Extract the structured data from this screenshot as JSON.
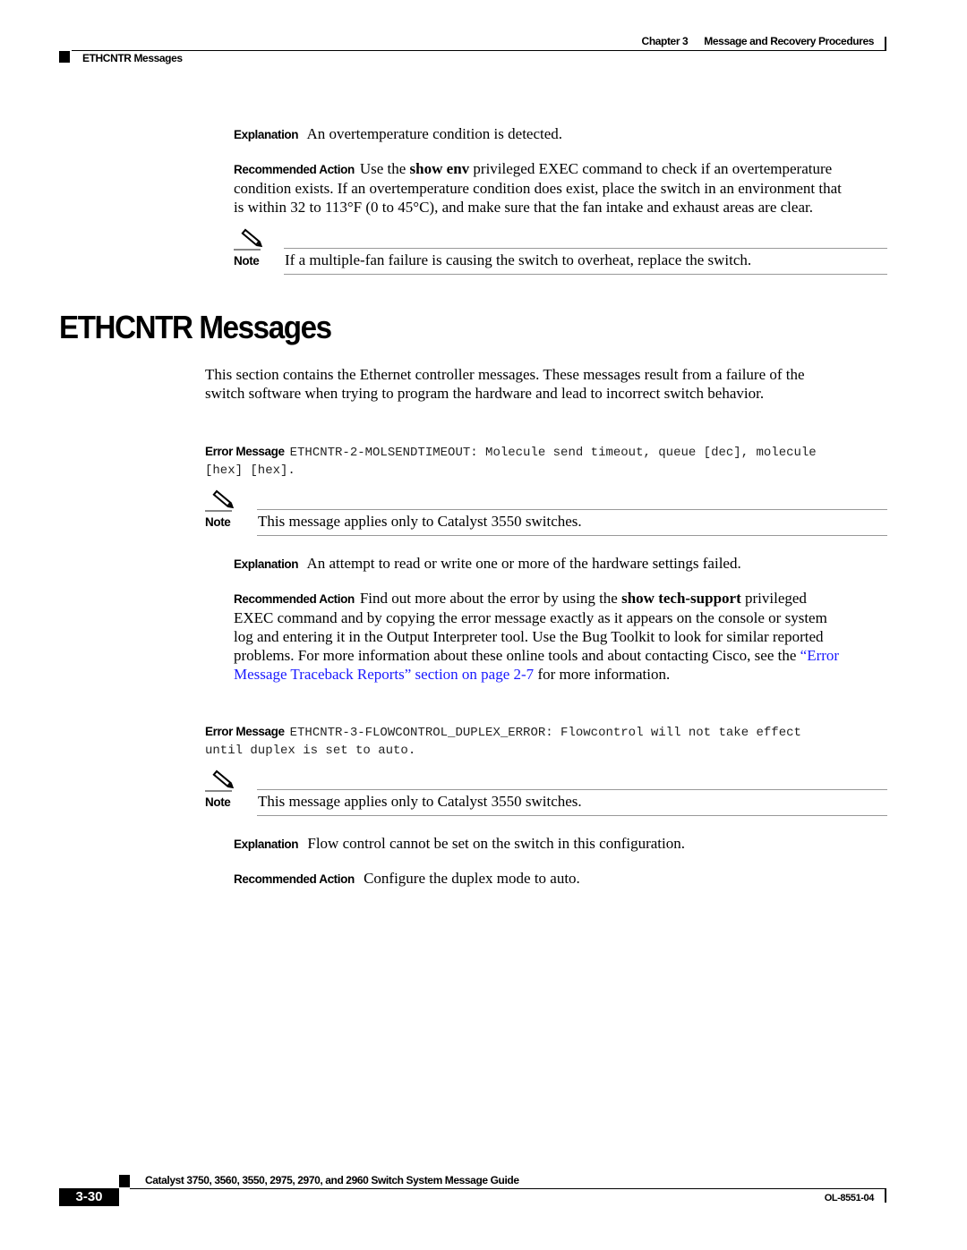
{
  "header": {
    "chapter": "Chapter 3",
    "chapter_title": "Message and Recovery Procedures",
    "section": "ETHCNTR Messages"
  },
  "top_block": {
    "explanation_label": "Explanation",
    "explanation_text": "An overtemperature condition is detected.",
    "action_label": "Recommended Action",
    "action_pre": "Use the ",
    "action_cmd": "show env",
    "action_line1_post": " privileged EXEC command to check if an overtemperature",
    "action_line2": "condition exists. If an overtemperature condition does exist, place the switch in an environment that",
    "action_line3": "is within 32 to 113°F (0 to 45°C), and make sure that the fan intake and exhaust areas are clear.",
    "note_label": "Note",
    "note_text": "If a multiple-fan failure is causing the switch to overheat, replace the switch."
  },
  "section": {
    "title": "ETHCNTR Messages",
    "intro_line1": "This section contains the Ethernet controller messages. These messages result from a failure of the",
    "intro_line2": "switch software when trying to program the hardware and lead to incorrect switch behavior."
  },
  "messages": [
    {
      "error_label": "Error Message",
      "code_line1": "ETHCNTR-2-MOLSENDTIMEOUT: Molecule send timeout, queue [dec], molecule",
      "code_line2": "[hex] [hex].",
      "note_label": "Note",
      "note_text": "This message applies only to Catalyst 3550 switches.",
      "explanation_label": "Explanation",
      "explanation_text": "An attempt to read or write one or more of the hardware settings failed.",
      "action_label": "Recommended Action",
      "action_pre": "Find out more about the error by using the ",
      "action_cmd": "show tech-support",
      "action_line1_post": " privileged",
      "action_line2": "EXEC command and by copying the error message exactly as it appears on the console or system",
      "action_line3": "log and entering it in the Output Interpreter tool. Use the Bug Toolkit to look for similar reported",
      "action_line4_pre": "problems. For more information about these online tools and about contacting Cisco, see the ",
      "action_link_part1": "“Error",
      "action_link_part2": "Message Traceback Reports” section on page 2-7",
      "action_line5_post": " for more information."
    },
    {
      "error_label": "Error Message",
      "code_line1": "ETHCNTR-3-FLOWCONTROL_DUPLEX_ERROR: Flowcontrol will not take effect",
      "code_line2": "until duplex is set to auto.",
      "note_label": "Note",
      "note_text": "This message applies only to Catalyst 3550 switches.",
      "explanation_label": "Explanation",
      "explanation_text": "Flow control cannot be set on the switch in this configuration.",
      "action_label": "Recommended Action",
      "action_text": "Configure the duplex mode to auto."
    }
  ],
  "footer": {
    "guide_title": "Catalyst 3750, 3560, 3550, 2975, 2970, and 2960 Switch System Message Guide",
    "page_number": "3-30",
    "doc_number": "OL-8551-04"
  },
  "colors": {
    "link": "#1a1aff",
    "rule": "#999999"
  }
}
